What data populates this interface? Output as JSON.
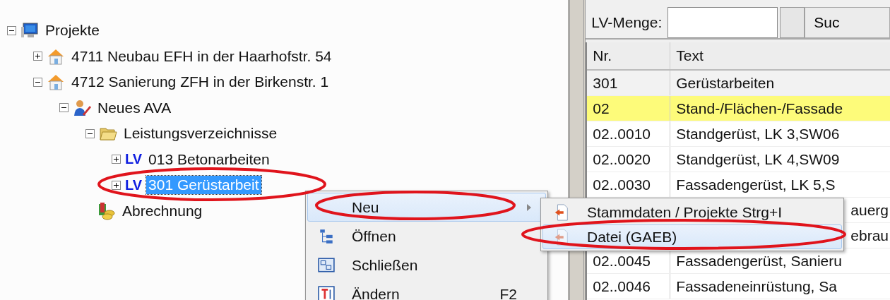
{
  "tree": [
    {
      "label": "Projekte",
      "kind": "computer",
      "expanded": true,
      "selected": false,
      "children": [
        {
          "label": "4711 Neubau EFH in der Haarhofstr. 54",
          "kind": "house",
          "expanded": false,
          "selected": false
        },
        {
          "label": "4712 Sanierung ZFH in der Birkenstr. 1",
          "kind": "house",
          "expanded": true,
          "selected": false,
          "children": [
            {
              "label": "Neues AVA",
              "kind": "user-pencil",
              "expanded": true,
              "selected": false,
              "children": [
                {
                  "label": "Leistungsverzeichnisse",
                  "kind": "folder",
                  "expanded": true,
                  "selected": false,
                  "children": [
                    {
                      "label": "013 Betonarbeiten",
                      "kind": "lv",
                      "badge": "LV",
                      "expanded": false,
                      "selected": false
                    },
                    {
                      "label": "301 Gerüstarbeit",
                      "kind": "lv",
                      "badge": "LV",
                      "expanded": false,
                      "selected": true
                    }
                  ]
                },
                {
                  "label": "Abrechnung",
                  "kind": "coins",
                  "selected": false
                }
              ]
            }
          ]
        }
      ]
    }
  ],
  "context_menu": [
    {
      "label": "Neu",
      "kind": "none",
      "selected": true,
      "submenu": true
    },
    {
      "label": "Öffnen",
      "kind": "tree",
      "selected": false,
      "submenu": false
    },
    {
      "label": "Schließen",
      "kind": "window",
      "selected": false,
      "submenu": false
    },
    {
      "label": "Ändern",
      "kind": "text",
      "shortcut": "F2",
      "selected": false,
      "submenu": false
    }
  ],
  "submenu": [
    {
      "label": "Stammdaten / Projekte Strg+I",
      "selected": false
    },
    {
      "label": "Datei (GAEB)",
      "selected": true
    }
  ],
  "toolbar": {
    "label": "LV-Menge:",
    "search_button": "Suc"
  },
  "table": {
    "columns": [
      "Nr.",
      "Text"
    ],
    "rows": [
      {
        "nr": "301",
        "text": "Gerüstarbeiten",
        "highlighted": false
      },
      {
        "nr": "02",
        "text": "Stand-/Flächen-/Fassade",
        "highlighted": true
      },
      {
        "nr": "02..0010",
        "text": "Standgerüst, LK 3,SW06",
        "highlighted": false
      },
      {
        "nr": "02..0020",
        "text": "Standgerüst, LK 4,SW09",
        "highlighted": false
      },
      {
        "nr": "02..0030",
        "text": "Fassadengerüst, LK 5,S",
        "highlighted": false
      },
      {
        "text": "auerg",
        "highlighted": false
      },
      {
        "text": "ebrau",
        "highlighted": false
      },
      {
        "nr": "02..0045",
        "text": "Fassadengerüst, Sanieru",
        "highlighted": false
      },
      {
        "nr": "02..0046",
        "text": "Fassadeneinrüstung, Sa",
        "highlighted": false
      }
    ]
  }
}
